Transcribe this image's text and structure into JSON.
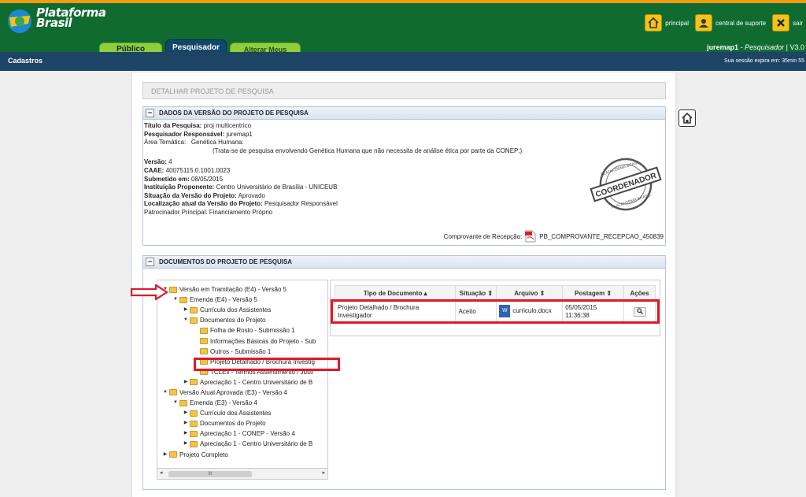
{
  "header": {
    "logo_text": [
      "Plataforma",
      "Brasil"
    ],
    "tabs": [
      "Público",
      "Pesquisador",
      "Alterar Meus Dados"
    ],
    "toolbar": {
      "principal": "principal",
      "suporte": "central de suporte",
      "sair": "sair"
    },
    "user": "juremap1",
    "role": "Pesquisador",
    "version": "V3.0"
  },
  "subbar": {
    "menu": "Cadastros",
    "session": "Sua sessão expira em: 35min 55"
  },
  "page_title": "DETALHAR PROJETO DE PESQUISA",
  "section1": {
    "title": "DADOS DA VERSÃO DO PROJETO DE PESQUISA",
    "fields": [
      {
        "label": "Título da Pesquisa:",
        "value": "proj multicentrico"
      },
      {
        "label": "Pesquisador Responsável:",
        "value": "juremap1"
      },
      {
        "label": "Área Temática:",
        "value": "Genética Humana:"
      },
      {
        "label": "",
        "value": "(Trata-se de pesquisa envolvendo Genética Humana que não necessita de análise ética por parte da CONEP;)"
      },
      {
        "label": "Versão:",
        "value": "4"
      },
      {
        "label": "CAAE:",
        "value": "40075115.0.1001.0023"
      },
      {
        "label": "Submetido em:",
        "value": "08/05/2015"
      },
      {
        "label": "Instituição Proponente:",
        "value": "Centro Universitário de Brasília - UNICEUB"
      },
      {
        "label": "Situação da Versão do Projeto:",
        "value": "Aprovado"
      },
      {
        "label": "Localização atual da Versão do Projeto:",
        "value": "Pesquisador Responsável"
      },
      {
        "label": "Patrocinador Principal:",
        "value": "Financiamento Próprio"
      }
    ],
    "stamp": {
      "top": "PLATAFORMA BRASIL",
      "center": "COORDENADOR",
      "bottom": "PLATAFORMA BRASIL"
    },
    "comprovante_label": "Comprovante de Recepção:",
    "comprovante_file": "PB_COMPROVANTE_RECEPCAO_450839"
  },
  "section2": {
    "title": "DOCUMENTOS DO PROJETO DE PESQUISA",
    "tree": [
      {
        "label": "Versão em Tramitação (E4) - Versão 5",
        "level": 0,
        "open": true
      },
      {
        "label": "Emenda (E4) - Versão 5",
        "level": 1,
        "open": true
      },
      {
        "label": "Currículo dos Assistentes",
        "level": 2,
        "open": false
      },
      {
        "label": "Documentos do Projeto",
        "level": 2,
        "open": true
      },
      {
        "label": "Folha de Rosto - Submissão 1",
        "level": 3,
        "open": null
      },
      {
        "label": "Informações Básicas do Projeto - Sub",
        "level": 3,
        "open": null
      },
      {
        "label": "Outros - Submissão 1",
        "level": 3,
        "open": null
      },
      {
        "label": "Projeto Detalhado / Brochura Investig",
        "level": 3,
        "open": null
      },
      {
        "label": "TCLEs - Termos Assentimento / Justi",
        "level": 3,
        "open": null
      },
      {
        "label": "Apreciação 1 - Centro Universitário de B",
        "level": 2,
        "open": false
      },
      {
        "label": "Versão Atual Aprovada (E3) - Versão 4",
        "level": 0,
        "open": true
      },
      {
        "label": "Emenda (E3) - Versão 4",
        "level": 1,
        "open": true
      },
      {
        "label": "Currículo dos Assistentes",
        "level": 2,
        "open": false
      },
      {
        "label": "Documentos do Projeto",
        "level": 2,
        "open": false
      },
      {
        "label": "Apreciação 1 - CONEP - Versão 4",
        "level": 2,
        "open": false
      },
      {
        "label": "Apreciação 1 - Centro Universitário de B",
        "level": 2,
        "open": false
      },
      {
        "label": "Projeto Completo",
        "level": 0,
        "open": false
      }
    ],
    "scrollbar_grip": "III",
    "table": {
      "headers": [
        "Tipo de Documento",
        "Situação",
        "Arquivo",
        "Postagem",
        "Ações"
      ],
      "row": {
        "tipo": "Projeto Detalhado / Brochura Investigador",
        "situacao": "Aceito",
        "arquivo": "curriculo.docx",
        "postagem": "05/05/2015 11:36:38"
      }
    }
  },
  "colors": {
    "header_green": "#0f6b2f",
    "subbar_blue": "#1d4464",
    "accent_orange": "#f39c12",
    "annotation_red": "#e0192a"
  }
}
